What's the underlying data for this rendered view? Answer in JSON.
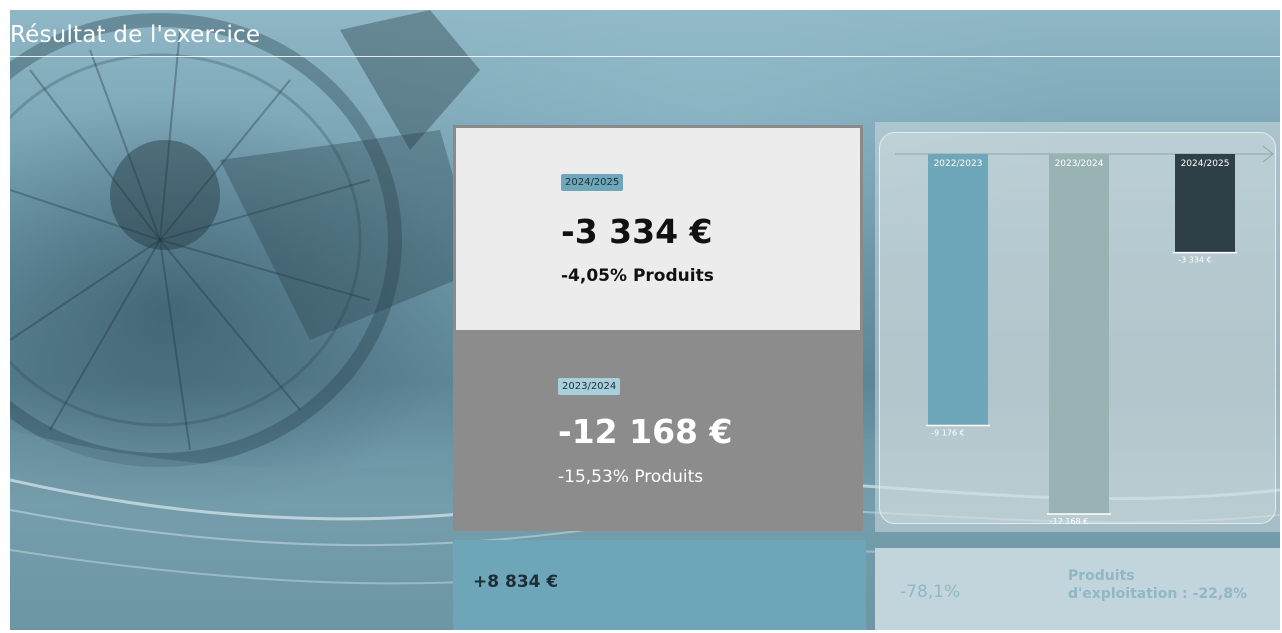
{
  "slide": {
    "title": "Résultat de l'exercice"
  },
  "current": {
    "year": "2024/2025",
    "amount": "-3 334 €",
    "pct_products": "-4,05% Produits"
  },
  "previous": {
    "year": "2023/2024",
    "amount": "-12 168 €",
    "pct_products": "-15,53% Produits"
  },
  "summary": {
    "delta": "+8 834 €",
    "ratio": "-78,1%",
    "produits_line1": "Produits",
    "produits_line2": "d'exploitation : -22,8%"
  },
  "chart_data": {
    "type": "bar",
    "categories": [
      "2022/2023",
      "2023/2024",
      "2024/2025"
    ],
    "values": [
      -9176,
      -12168,
      -3334
    ],
    "value_labels": [
      "-9 176 €",
      "-12 168 €",
      "-3 334 €"
    ],
    "colors": [
      "#6ea7ba",
      "#99b2b4",
      "#2e3f48"
    ],
    "title": "",
    "xlabel": "",
    "ylabel": "",
    "ylim": [
      -12168,
      0
    ],
    "grid": false
  },
  "colors": {
    "accent": "#6ea6b9",
    "dark": "#2e3f48",
    "panel_light": "#ececec",
    "panel_gray": "#8c8c8c"
  }
}
